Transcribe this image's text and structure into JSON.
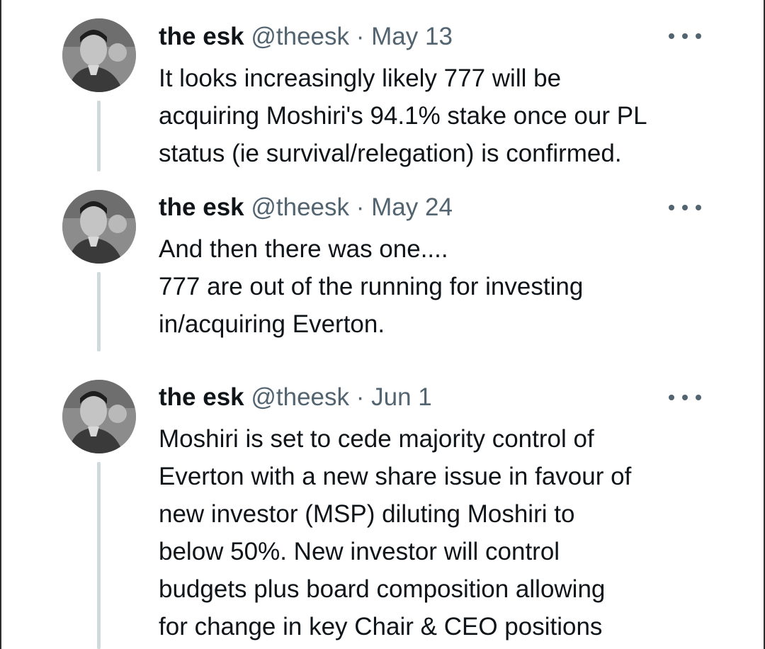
{
  "tweets": [
    {
      "name": "the esk",
      "handle": "@theesk",
      "separator": "·",
      "date": "May 13",
      "more_icon": "more-horizontal-icon",
      "lines": [
        "It looks increasingly likely 777 will be",
        "acquiring Moshiri's 94.1% stake once our PL",
        "status (ie survival/relegation) is confirmed."
      ]
    },
    {
      "name": "the esk",
      "handle": "@theesk",
      "separator": "·",
      "date": "May 24",
      "more_icon": "more-horizontal-icon",
      "lines": [
        "And then there was one....",
        "777 are out of the running for investing",
        "in/acquiring Everton."
      ]
    },
    {
      "name": "the esk",
      "handle": "@theesk",
      "separator": "·",
      "date": "Jun 1",
      "more_icon": "more-horizontal-icon",
      "lines": [
        "Moshiri is set to cede majority control of",
        "Everton with a new share issue in favour of",
        "new investor (MSP) diluting Moshiri to",
        "below 50%. New investor will control",
        "budgets plus board composition allowing",
        "for change in key Chair & CEO positions"
      ]
    }
  ],
  "colors": {
    "text": "#0f1419",
    "secondary": "#536471",
    "thread_line": "#cfd9de"
  }
}
